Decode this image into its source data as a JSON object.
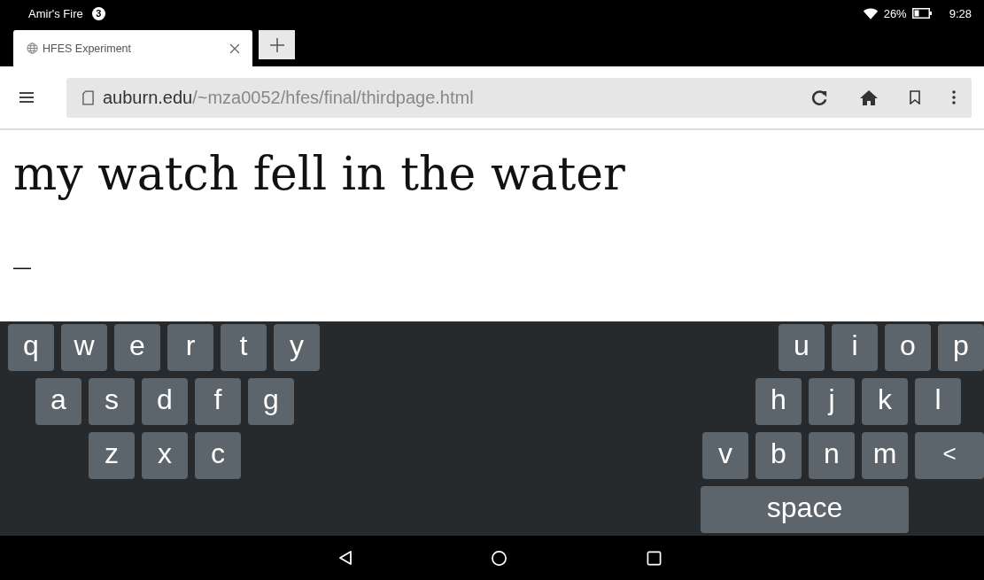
{
  "status_bar": {
    "device_name": "Amir's Fire",
    "notification_count": "3",
    "battery": "26%",
    "time": "9:28"
  },
  "tabs": [
    {
      "title": "HFES Experiment",
      "selected": true
    }
  ],
  "address_bar": {
    "domain": "auburn.edu",
    "path": "/~mza0052/hfes/final/thirdpage.html"
  },
  "page": {
    "phrase": "my watch fell in the water",
    "typed_text": "_"
  },
  "keyboard": {
    "rows": [
      {
        "left": [
          {
            "label": "q",
            "kind": "letter"
          },
          {
            "label": "w",
            "kind": "letter"
          },
          {
            "label": "e",
            "kind": "letter"
          },
          {
            "label": "r",
            "kind": "letter"
          },
          {
            "label": "t",
            "kind": "letter"
          },
          {
            "label": "y",
            "kind": "letter"
          }
        ],
        "right": [
          {
            "label": "u",
            "kind": "letter"
          },
          {
            "label": "i",
            "kind": "letter"
          },
          {
            "label": "o",
            "kind": "letter"
          },
          {
            "label": "p",
            "kind": "letter"
          }
        ]
      },
      {
        "left": [
          {
            "label": "a",
            "kind": "letter"
          },
          {
            "label": "s",
            "kind": "letter"
          },
          {
            "label": "d",
            "kind": "letter"
          },
          {
            "label": "f",
            "kind": "letter"
          },
          {
            "label": "g",
            "kind": "letter"
          }
        ],
        "right": [
          {
            "label": "h",
            "kind": "letter"
          },
          {
            "label": "j",
            "kind": "letter"
          },
          {
            "label": "k",
            "kind": "letter"
          },
          {
            "label": "l",
            "kind": "letter"
          }
        ]
      },
      {
        "left": [
          {
            "label": "z",
            "kind": "letter"
          },
          {
            "label": "x",
            "kind": "letter"
          },
          {
            "label": "c",
            "kind": "letter"
          }
        ],
        "right": [
          {
            "label": "v",
            "kind": "letter"
          },
          {
            "label": "b",
            "kind": "letter"
          },
          {
            "label": "n",
            "kind": "letter"
          },
          {
            "label": "m",
            "kind": "letter"
          },
          {
            "label": "<",
            "kind": "backspace"
          }
        ]
      },
      {
        "left": [],
        "right": [
          {
            "label": "space",
            "kind": "space"
          }
        ]
      }
    ]
  }
}
